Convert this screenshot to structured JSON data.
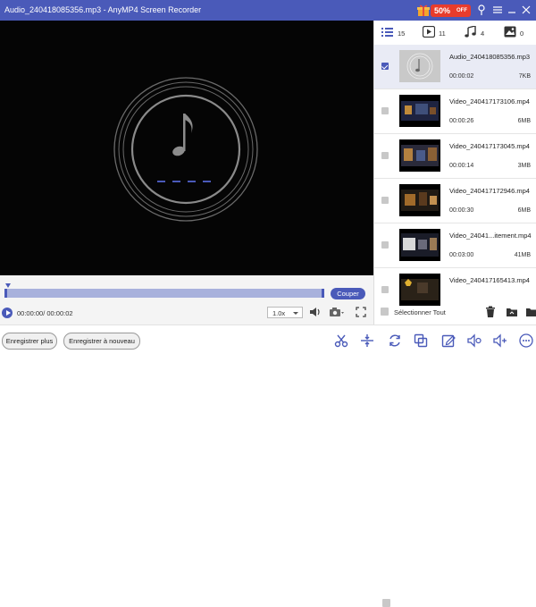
{
  "window": {
    "title": "Audio_240418085356.mp3 - AnyMP4 Screen Recorder",
    "promo": "50%",
    "promo_suffix": "OFF",
    "accent": "#4a5ab9",
    "icons": [
      "gift-icon",
      "pin-icon",
      "menu-icon",
      "minimize-icon",
      "maximize-icon",
      "close-icon"
    ]
  },
  "tabs": [
    {
      "icon": "list-icon",
      "count": "15"
    },
    {
      "icon": "video-icon",
      "count": "11"
    },
    {
      "icon": "music-icon",
      "count": "4"
    },
    {
      "icon": "image-icon",
      "count": "0"
    }
  ],
  "recordings": [
    {
      "name": "Audio_240418085356.mp3",
      "duration": "00:00:02",
      "size": "7KB",
      "selected": true,
      "type": "audio"
    },
    {
      "name": "Video_240417173106.mp4",
      "duration": "00:00:26",
      "size": "6MB",
      "selected": false,
      "type": "video"
    },
    {
      "name": "Video_240417173045.mp4",
      "duration": "00:00:14",
      "size": "3MB",
      "selected": false,
      "type": "video"
    },
    {
      "name": "Video_240417172946.mp4",
      "duration": "00:00:30",
      "size": "6MB",
      "selected": false,
      "type": "video"
    },
    {
      "name": "Video_24041...itement.mp4",
      "duration": "00:03:00",
      "size": "41MB",
      "selected": false,
      "type": "video"
    },
    {
      "name": "Video_240417165413.mp4",
      "duration": "",
      "size": "",
      "selected": false,
      "type": "video"
    }
  ],
  "select_all_label": "Sélectionner Tout",
  "playback": {
    "time": "00:00:00/ 00:00:02",
    "speed": "1.0x",
    "cut_label": "Couper"
  },
  "footer": {
    "record_more": "Enregistrer plus",
    "record_again": "Enregistrer à nouveau",
    "tools": [
      "scissors-icon",
      "align-icon",
      "convert-icon",
      "merge-icon",
      "edit-icon",
      "volume-adjust-icon",
      "volume-boost-icon",
      "more-icon"
    ]
  }
}
